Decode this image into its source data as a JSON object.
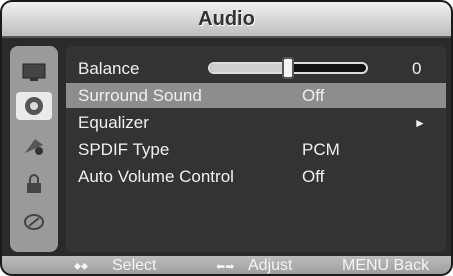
{
  "title": "Audio",
  "menu": {
    "balance": {
      "label": "Balance",
      "value": "0",
      "level": 0.5
    },
    "surround": {
      "label": "Surround Sound",
      "value": "Off"
    },
    "equalizer": {
      "label": "Equalizer",
      "arrow": "►"
    },
    "spdif": {
      "label": "SPDIF Type",
      "value": "PCM"
    },
    "avc": {
      "label": "Auto Volume Control",
      "value": "Off"
    }
  },
  "side_icons": [
    "picture-icon",
    "audio-icon",
    "settings-icon",
    "lock-icon",
    "input-icon"
  ],
  "footer": {
    "select_symbol": "⬥⬥",
    "select_label": "Select",
    "adjust_symbol": "⬅➡",
    "adjust_label": "Adjust",
    "back_label": "MENU Back"
  },
  "colors": {
    "highlight": "#8d8d8d",
    "text": "#f0f0f0"
  }
}
